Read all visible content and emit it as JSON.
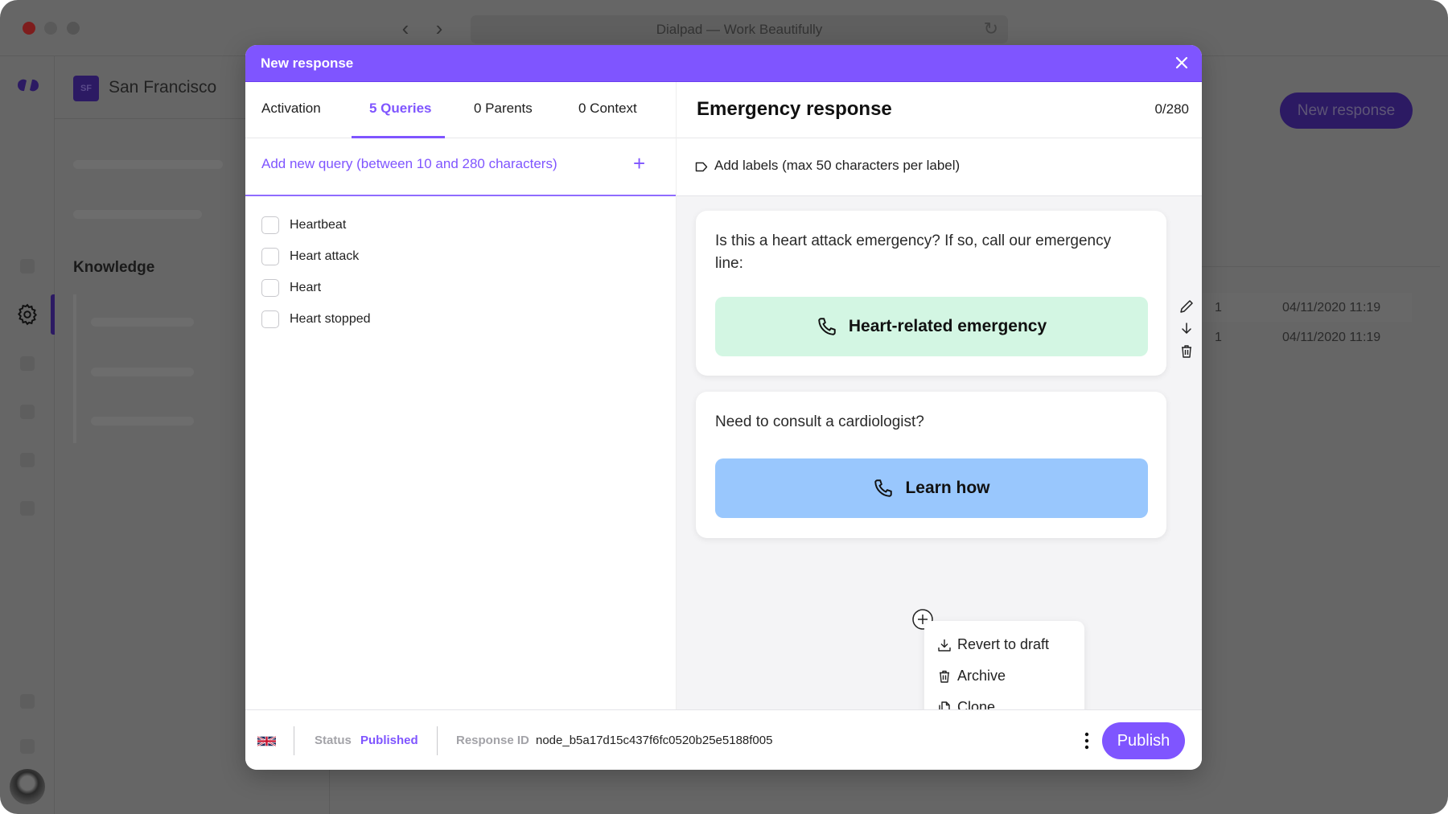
{
  "browser": {
    "title": "Dialpad — Work Beautifully",
    "back_icon": "chevron-left-icon",
    "forward_icon": "chevron-right-icon",
    "reload_icon": "reload-icon"
  },
  "colors": {
    "accent": "#7f55ff",
    "dark_brand": "#2c1a63",
    "green_button": "#d3f6e3",
    "blue_button": "#99c7fd"
  },
  "sidebar": {
    "org_badge": "SF",
    "org_name": "San Francisco",
    "section_title": "Knowledge"
  },
  "background": {
    "new_response_button": "New response",
    "rows": [
      {
        "count": "1",
        "date": "04/11/2020 11:19"
      },
      {
        "count": "1",
        "date": "04/11/2020 11:19"
      }
    ]
  },
  "modal": {
    "title": "New response",
    "tabs": [
      {
        "label": "Activation",
        "active": false
      },
      {
        "label": "5 Queries",
        "active": true
      },
      {
        "label": "0 Parents",
        "active": false
      },
      {
        "label": "0 Context",
        "active": false
      }
    ],
    "query_placeholder": "Add new query (between 10 and 280 characters)",
    "query_add": "+",
    "queries": [
      {
        "label": "Heartbeat",
        "checked": false
      },
      {
        "label": "Heart attack",
        "checked": false
      },
      {
        "label": "Heart",
        "checked": false
      },
      {
        "label": "Heart stopped",
        "checked": false
      }
    ],
    "response_title": "Emergency response",
    "char_count": "0/280",
    "labels_placeholder": "Add labels (max 50 characters per label)",
    "cards": [
      {
        "text": "Is this a heart attack emergency? If so, call our emergency line:",
        "button": "Heart-related emergency",
        "button_icon": "phone-icon"
      },
      {
        "text": "Need to consult a cardiologist?",
        "button": "Learn how",
        "button_icon": "phone-icon"
      }
    ],
    "card_tools": [
      "pencil-icon",
      "arrow-down-icon",
      "trash-icon"
    ],
    "menu": [
      {
        "label": "Revert to draft",
        "icon": "download-icon"
      },
      {
        "label": "Archive",
        "icon": "trash-icon"
      },
      {
        "label": "Clone",
        "icon": "copy-icon"
      }
    ],
    "footer": {
      "language_flag": "uk-flag-icon",
      "status_label": "Status",
      "status_value": "Published",
      "response_id_label": "Response ID",
      "response_id_value": "node_b5a17d15c437f6fc0520b25e5188f005",
      "publish_button": "Publish"
    }
  }
}
